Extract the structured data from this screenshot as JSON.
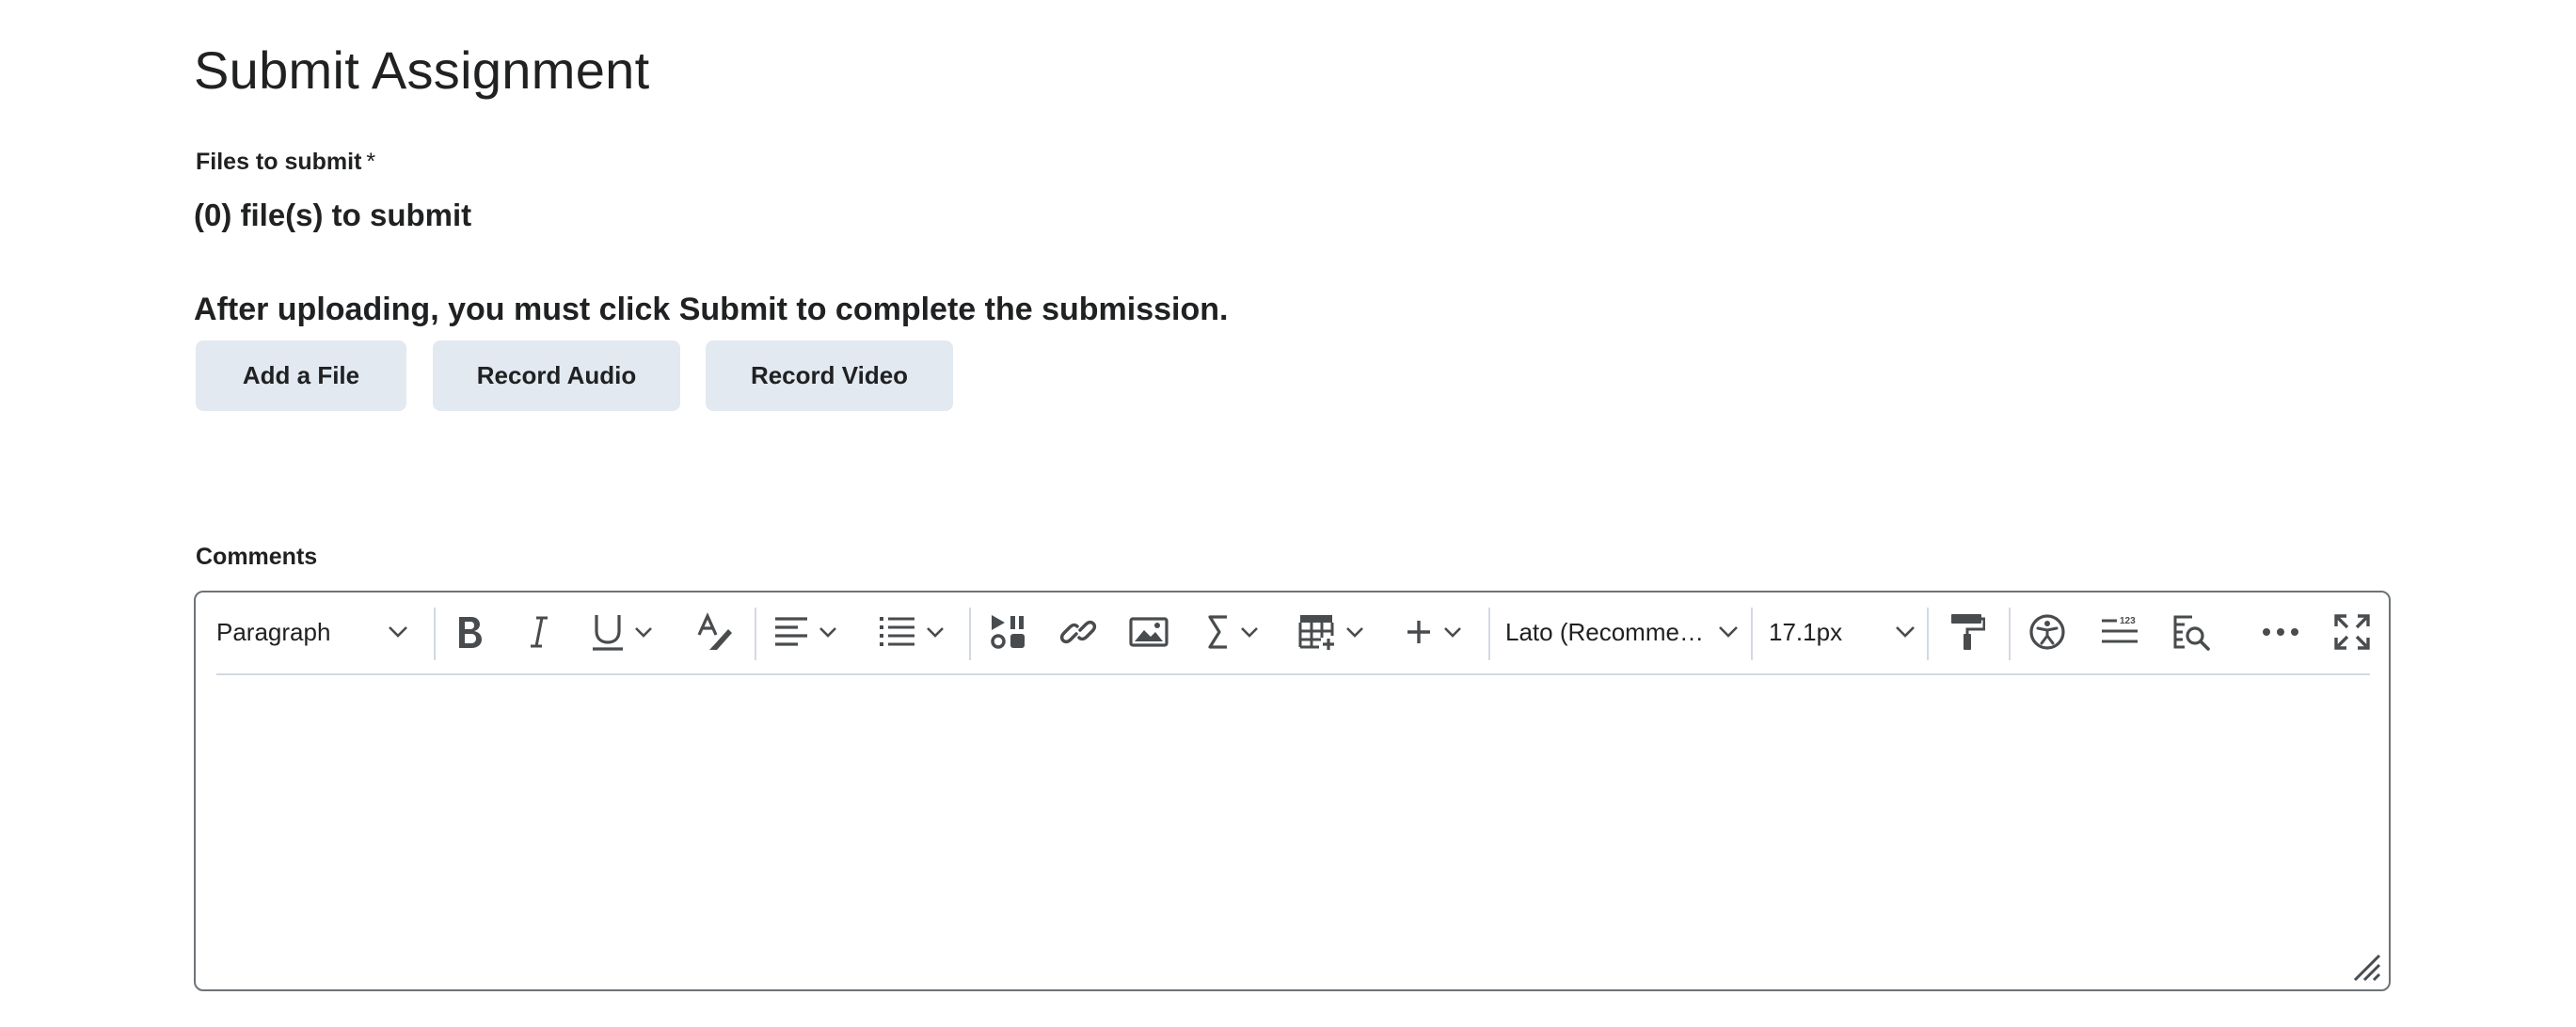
{
  "page": {
    "title": "Submit Assignment"
  },
  "files": {
    "label": "Files to submit",
    "required_mark": "*",
    "count_text": "(0) file(s) to submit",
    "note": "After uploading, you must click Submit to complete the submission."
  },
  "buttons": {
    "add_file": "Add a File",
    "record_audio": "Record Audio",
    "record_video": "Record Video"
  },
  "comments": {
    "label": "Comments",
    "body_text": ""
  },
  "toolbar": {
    "block_format": "Paragraph",
    "font_family": "Lato (Recomme…",
    "font_size": "17.1px",
    "icons": [
      "bold-icon",
      "italic-icon",
      "underline-icon",
      "text-style-icon",
      "align-left-icon",
      "bullet-list-icon",
      "media-icon",
      "link-icon",
      "image-icon",
      "equation-icon",
      "table-icon",
      "insert-plus-icon",
      "format-painter-icon",
      "accessibility-icon",
      "word-count-icon",
      "find-replace-icon",
      "more-icon",
      "fullscreen-icon"
    ]
  },
  "colors": {
    "button_bg": "#e3e9f1",
    "text": "#202122",
    "icon": "#494c4e",
    "border": "#6e7376"
  }
}
